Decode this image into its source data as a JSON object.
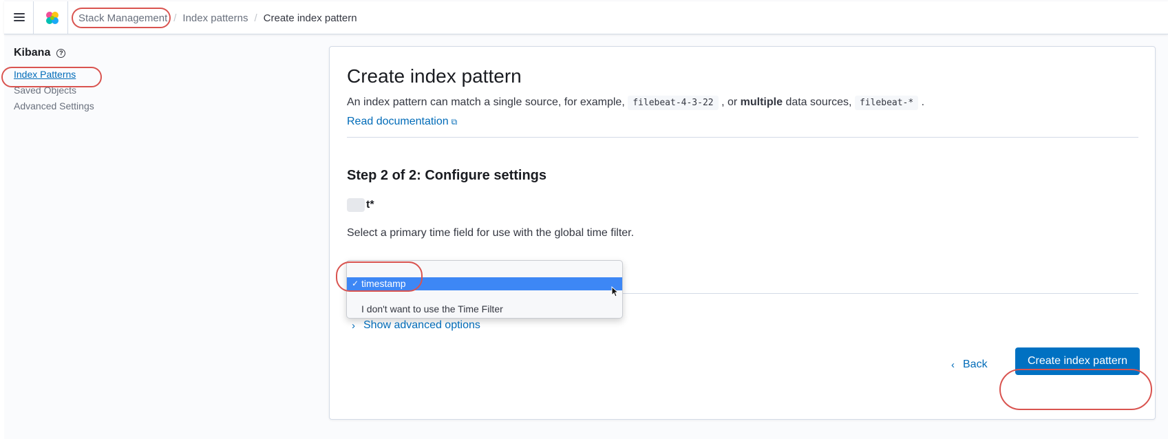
{
  "header": {
    "breadcrumbs": [
      "Stack Management",
      "Index patterns",
      "Create index pattern"
    ],
    "breadcrumb_separator": "/"
  },
  "sidebar": {
    "title": "Kibana",
    "items": [
      {
        "label": "Index Patterns",
        "active": true
      },
      {
        "label": "Saved Objects",
        "active": false
      },
      {
        "label": "Advanced Settings",
        "active": false
      }
    ]
  },
  "main": {
    "title": "Create index pattern",
    "description": {
      "part1": "An index pattern can match a single source, for example, ",
      "code1": "filebeat-4-3-22",
      "part2": ", or ",
      "bold": "multiple",
      "part3": " data sources, ",
      "code2": "filebeat-*",
      "part4": "."
    },
    "doc_link": "Read documentation",
    "step_title": "Step 2 of 2: Configure settings",
    "pattern_suffix": "t*",
    "time_field_hint": "Select a primary time field for use with the global time filter.",
    "time_field_options": [
      {
        "label": "timestamp",
        "selected": true
      },
      {
        "label": "I don't want to use the Time Filter",
        "selected": false
      }
    ],
    "advanced_options": "Show advanced options",
    "back_button": "Back",
    "create_button": "Create index pattern"
  },
  "colors": {
    "accent": "#006bb8",
    "primary_button": "#0071c2",
    "selected_option": "#3d87f5",
    "callout": "#d9534f"
  },
  "icons": [
    "menu-icon",
    "kibana-logo-icon",
    "help-icon",
    "external-link-icon",
    "checkmark-icon",
    "chevron-right-icon",
    "chevron-left-icon",
    "mouse-cursor-icon"
  ]
}
